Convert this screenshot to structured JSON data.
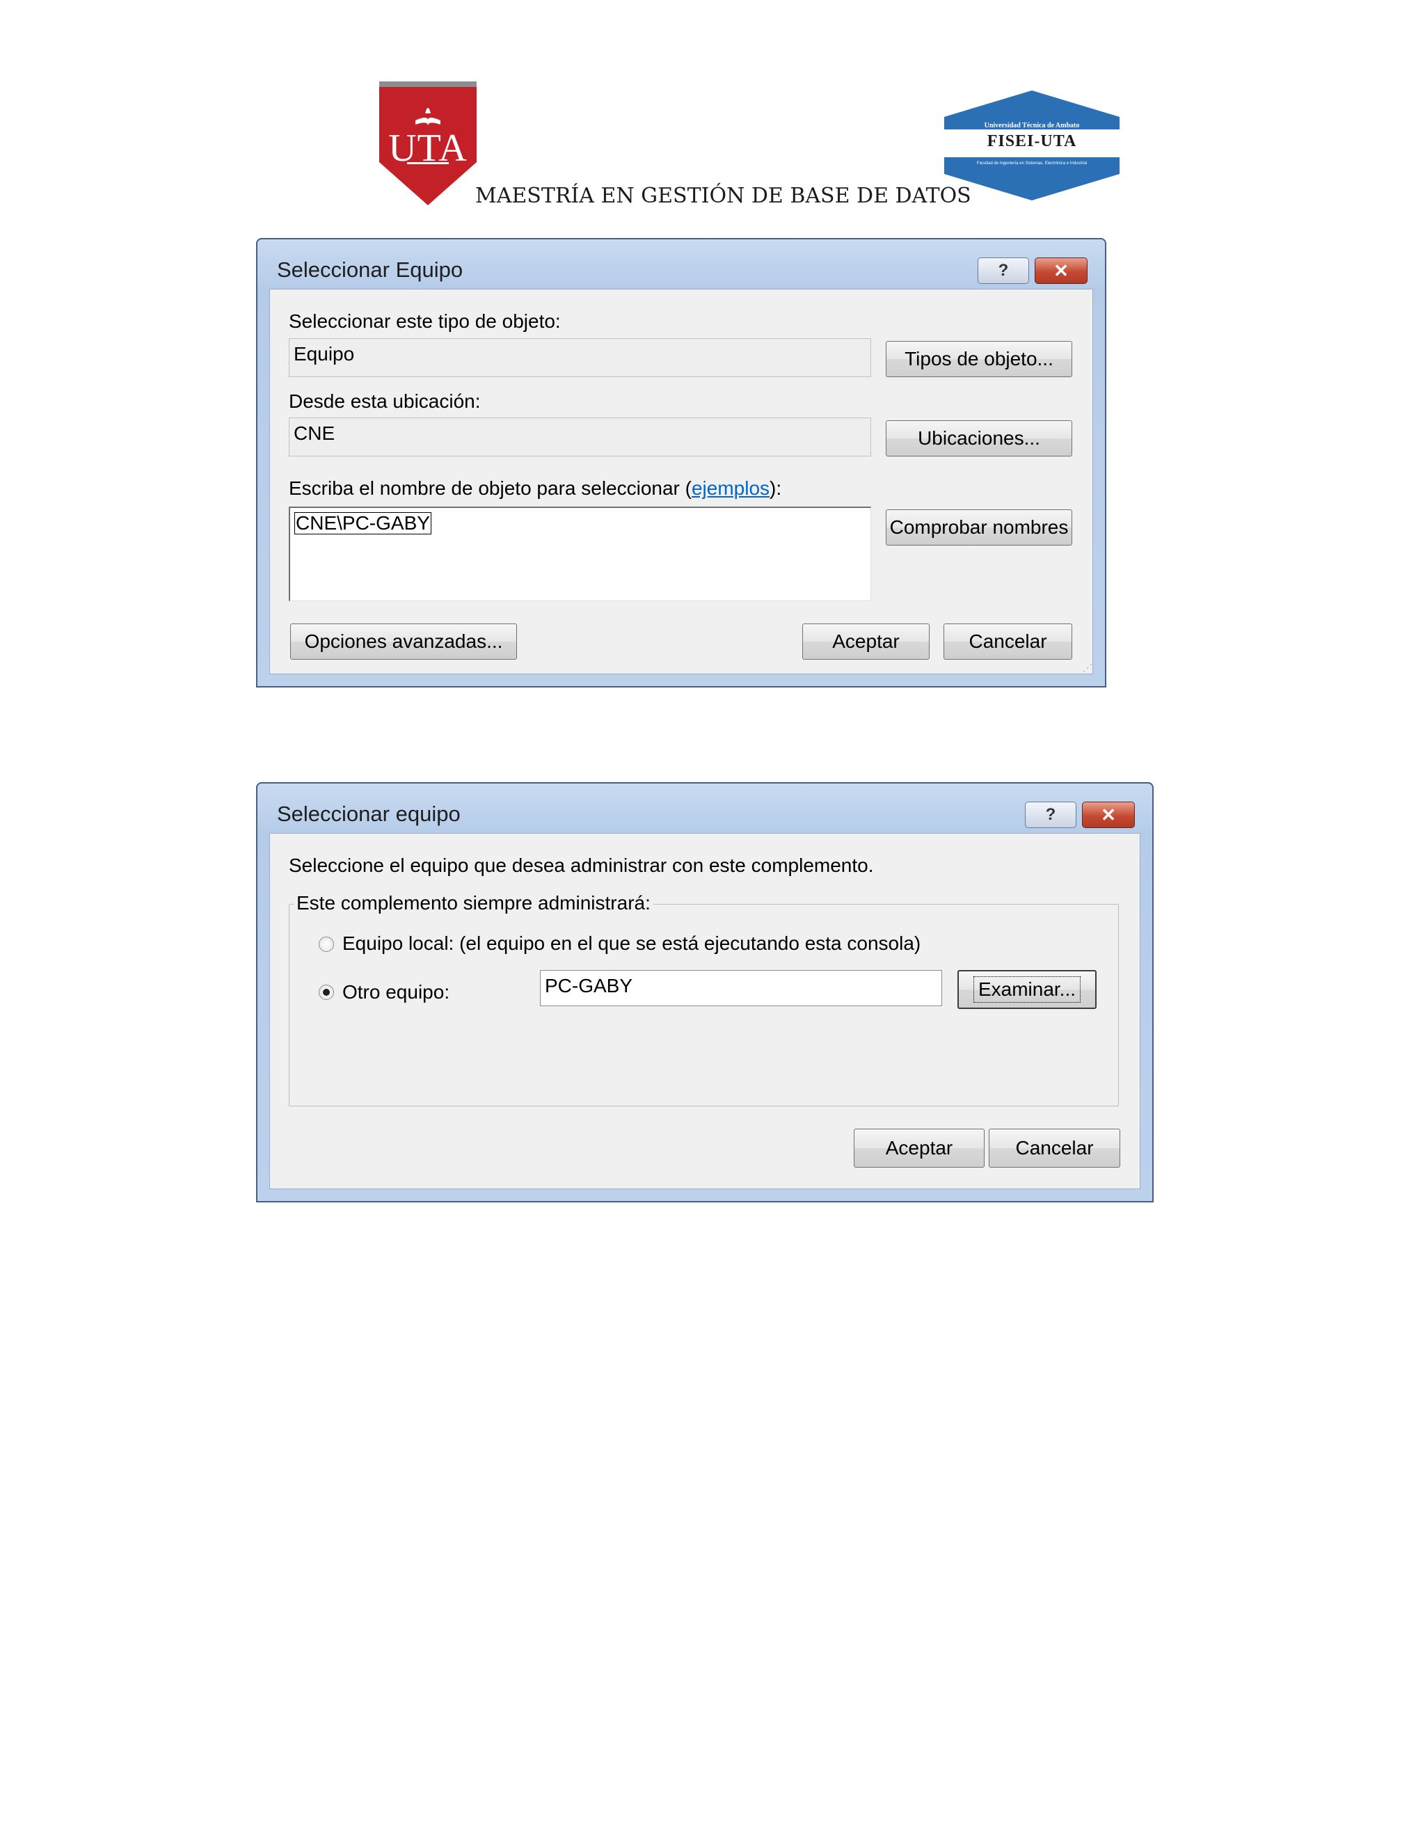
{
  "header": {
    "left_logo": {
      "text": "UTA",
      "colors": {
        "shield": "#c42028",
        "bar": "#8d8d8d"
      }
    },
    "right_logo": {
      "top_text": "Universidad Técnica de Ambato",
      "main_text": "FISEI-UTA",
      "sub_text": "Facultad de Ingeniería en Sistemas, Electrónica e Industrial",
      "colors": {
        "hexagon": "#2b6fb5",
        "band": "#ffffff"
      }
    },
    "title": "MAESTRÍA EN GESTIÓN DE BASE DE DATOS"
  },
  "dialog1": {
    "title": "Seleccionar Equipo",
    "help_icon": "question-icon",
    "close_icon": "close-x-icon",
    "object_type_label": "Seleccionar este tipo de objeto:",
    "object_type_value": "Equipo",
    "object_types_button": "Tipos de objeto...",
    "location_label": "Desde esta ubicación:",
    "location_value": "CNE",
    "locations_button": "Ubicaciones...",
    "names_label_pre": "Escriba el nombre de objeto para seleccionar (",
    "names_label_link": "ejemplos",
    "names_label_post": "):",
    "names_value": "CNE\\PC-GABY",
    "check_names_button": "Comprobar nombres",
    "advanced_button": "Opciones avanzadas...",
    "ok_button": "Aceptar",
    "cancel_button": "Cancelar"
  },
  "dialog2": {
    "title": "Seleccionar equipo",
    "help_icon": "question-icon",
    "close_icon": "close-x-icon",
    "instruction": "Seleccione el equipo que desea administrar con este complemento.",
    "group_label": "Este complemento siempre administrará:",
    "option_local": "Equipo local: (el equipo en el que se está ejecutando esta consola)",
    "option_other": "Otro equipo:",
    "selected_option": "option_other",
    "other_computer_value": "PC-GABY",
    "browse_button": "Examinar...",
    "ok_button": "Aceptar",
    "cancel_button": "Cancelar"
  }
}
